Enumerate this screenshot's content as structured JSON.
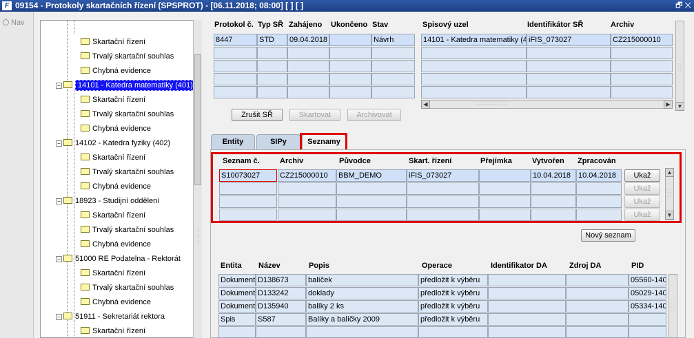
{
  "window": {
    "title": "09154 - Protokoly skartačních řízení (SPSPROT) - [06.11.2018; 08:00]  [ ]  [ ]",
    "logo": "F",
    "controls": "🗗 ✕"
  },
  "nav": {
    "label": "Nav"
  },
  "tree": {
    "nodes": [
      {
        "label": "Skartační řízení"
      },
      {
        "label": "Trvalý skartační souhlas"
      },
      {
        "label": "Chybná evidence"
      },
      {
        "label": "14101 - Katedra matematiky (401)"
      },
      {
        "label": "Skartační řízení"
      },
      {
        "label": "Trvalý skartační souhlas"
      },
      {
        "label": "Chybná evidence"
      },
      {
        "label": "14102 - Katedra fyziky (402)"
      },
      {
        "label": "Skartační řízení"
      },
      {
        "label": "Trvalý skartační souhlas"
      },
      {
        "label": "Chybná evidence"
      },
      {
        "label": "18923 - Studijní oddělení"
      },
      {
        "label": "Skartační řízení"
      },
      {
        "label": "Trvalý skartační souhlas"
      },
      {
        "label": "Chybná evidence"
      },
      {
        "label": "51000 RE Podatelna - Rektorát"
      },
      {
        "label": "Skartační řízení"
      },
      {
        "label": "Trvalý skartační souhlas"
      },
      {
        "label": "Chybná evidence"
      },
      {
        "label": "51911 - Sekretariát rektora"
      },
      {
        "label": "Skartační řízení"
      }
    ]
  },
  "protocols": {
    "headers": {
      "protokol": "Protokol č.",
      "typ": "Typ SŘ",
      "zahajeno": "Zahájeno",
      "ukonceno": "Ukončeno",
      "stav": "Stav",
      "uzel": "Spisový uzel",
      "ident": "Identifikátor SŘ",
      "archiv": "Archiv"
    },
    "row1": {
      "protokol": "8447",
      "typ": "STD",
      "zahajeno": "09.04.2018",
      "ukonceno": "",
      "stav": "Návrh",
      "uzel": "14101 - Katedra matematiky (4",
      "ident": "iFIS_073027",
      "archiv": "CZ215000010"
    },
    "buttons": {
      "zrusit": "Zrušit SŘ",
      "skartovat": "Skartovat",
      "archivovat": "Archivovat"
    }
  },
  "tabs": {
    "entity": "Entity",
    "sipy": "SIPy",
    "seznamy": "Seznamy"
  },
  "lists": {
    "headers": {
      "seznam": "Seznam č.",
      "archiv": "Archiv",
      "puvodce": "Původce",
      "skart": "Skart. řízení",
      "prejimka": "Přejímka",
      "vytvoren": "Vytvořen",
      "zpracovan": "Zpracován"
    },
    "row1": {
      "seznam": "S10073027",
      "archiv": "CZ215000010",
      "puvodce": "BBM_DEMO",
      "skart": "iFIS_073027",
      "prejimka": "",
      "vytvoren": "10.04.2018",
      "zpracovan": "10.04.2018"
    },
    "ukaz": "Ukaž",
    "novy": "Nový seznam"
  },
  "entities": {
    "headers": {
      "entita": "Entita",
      "nazev": "Název",
      "popis": "Popis",
      "operace": "Operace",
      "identDA": "Identifikator DA",
      "zdrojDA": "Zdroj DA",
      "pid": "PID"
    },
    "rows": [
      {
        "entita": "Dokument",
        "nazev": "D138673",
        "popis": "balíček",
        "operace": "předložit k výběru",
        "pid": "05560-140"
      },
      {
        "entita": "Dokument",
        "nazev": "D133242",
        "popis": "doklady",
        "operace": "předložit k výběru",
        "pid": "05029-140"
      },
      {
        "entita": "Dokument",
        "nazev": "D135940",
        "popis": "balíky 2 ks",
        "operace": "předložit k výběru",
        "pid": "05334-140"
      },
      {
        "entita": "Spis",
        "nazev": "S587",
        "popis": "Balíky a balíčky 2009",
        "operace": "předložit k výběru",
        "pid": ""
      }
    ]
  }
}
